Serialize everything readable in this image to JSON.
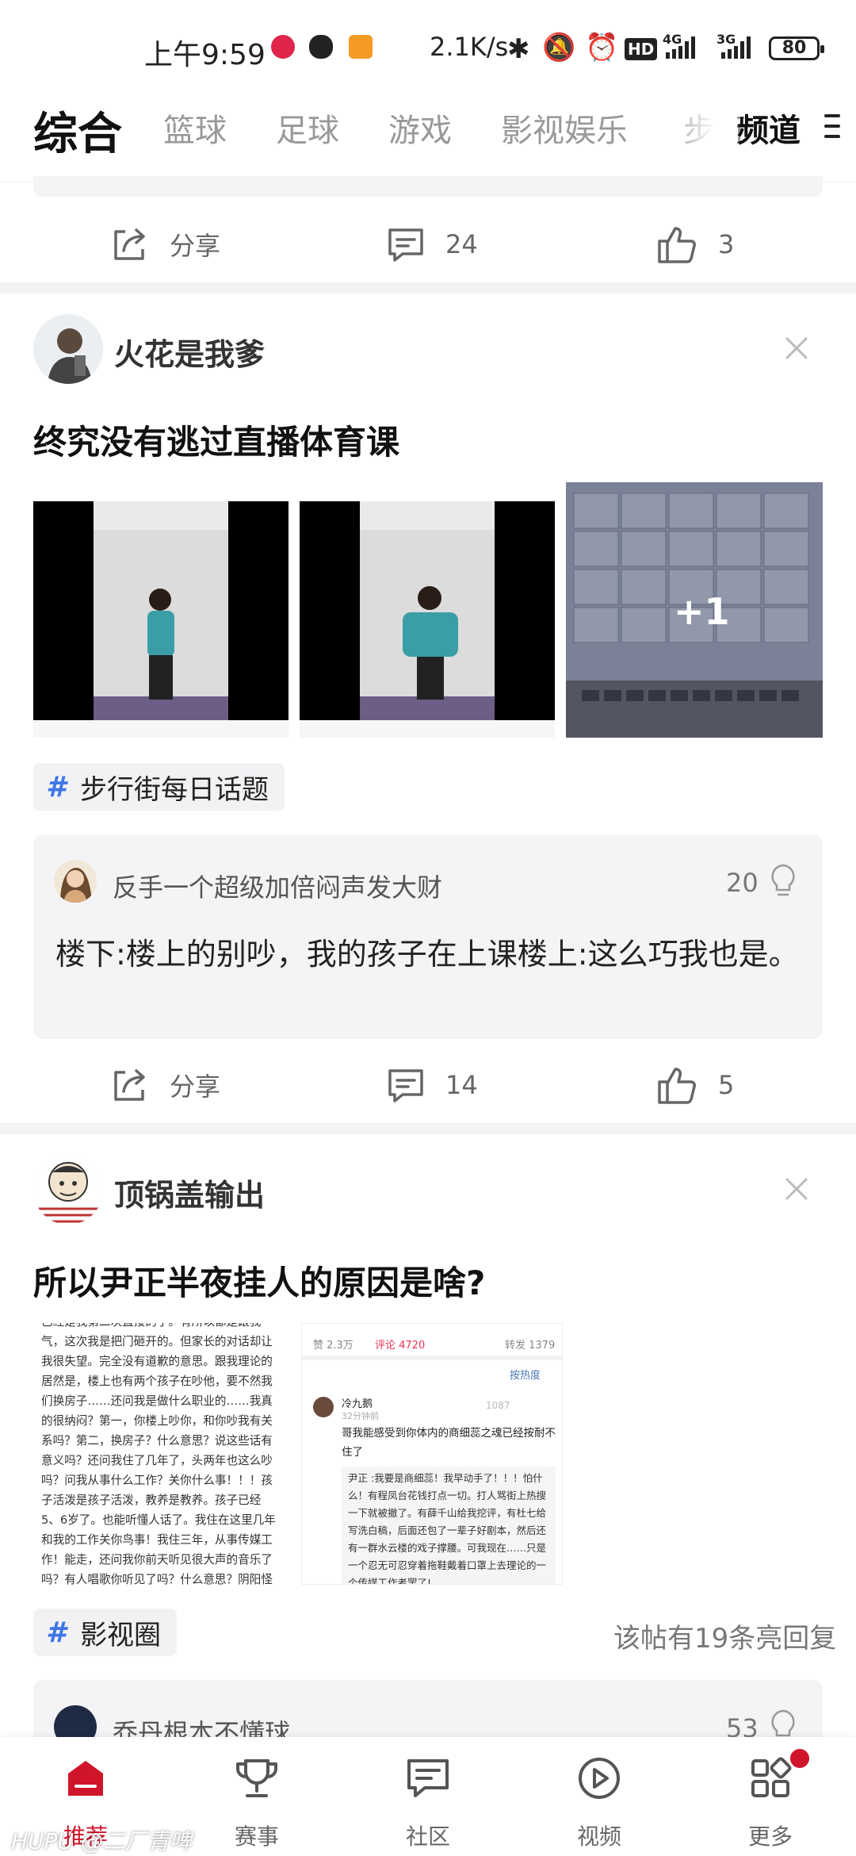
{
  "status_bar": {
    "time": "上午9:59",
    "network_speed": "2.1K/s",
    "hd": "HD",
    "net1": "4G",
    "net2": "3G",
    "battery": "80"
  },
  "tabs": {
    "items": [
      "综合",
      "篮球",
      "足球",
      "游戏",
      "影视娱乐",
      "步行"
    ],
    "channel_label": "频道"
  },
  "post0": {
    "share": "分享",
    "comments": "24",
    "likes": "3"
  },
  "post1": {
    "author": "火花是我爹",
    "title": "终究没有逃过直播体育课",
    "more_images": "+1",
    "topic": "步行街每日话题",
    "top_comment": {
      "user": "反手一个超级加倍闷声发大财",
      "lights": "20",
      "text": "楼下:楼上的别吵，我的孩子在上课楼上:这么巧我也是。"
    },
    "share": "分享",
    "comments": "14",
    "likes": "5"
  },
  "post2": {
    "author": "顶锅盖输出",
    "title": "所以尹正半夜挂人的原因是啥?",
    "topic": "影视圈",
    "hot_replies": "该帖有19条亮回复",
    "top_comment": {
      "user": "乔丹根本不懂球",
      "lights": "53"
    },
    "left_image_text": "已经是我第二次直接的了。有所以都是跟我气，这次我是把门砸开的。但家长的对话却让我很失望。完全没有道歉的意思。跟我理论的居然是，楼上也有两个孩子在吵他，要不然我们换房子……还问我是做什么职业的……我真的很纳闷？第一，你楼上吵你，和你吵我有关系吗？第二，换房子？什么意思？说这些话有意义吗？还问我住了几年了，头两年也这么吵吗？问我从事什么工作？关你什么事！！！孩子活泼是孩子活泼，教养是教养。孩子已经5、6岁了。也能听懂人话了。我住在这里几年和我的工作关你鸟事！我住三年，从事传媒工作！能走，还问我你前天听见很大声的音乐了吗？有人唱歌你听见了吗？什么意思？阴阳怪气。我问，我在卧室听的。吵到你了吗？唱歌？那",
    "right_image": {
      "likes": "赞 2.3万",
      "comments_tab": "评论 4720",
      "reposts": "转发 1379",
      "sort": "按热度",
      "commenter": "冷九鹅",
      "comment_time": "32分钟前",
      "comment_likes": "1087",
      "comment_text": "哥我能感受到你体内的商细蕊之魂已经按耐不住了",
      "reply": "尹正 :我要是商细蕊！我早动手了！！！怕什么！有程凤台花钱打点一切。打人骂街上热搜一下就被撤了。有薛千山给我挖评，有杜七给写洗白稿，后面还包了一辈子好剧本，然后还有一群水云楼的戏子撑腰。可我现在……只是一个忍无可忍穿着拖鞋戴着口罩上去理论的一个传媒工作者罢了!"
    }
  },
  "bottom_nav": {
    "items": [
      "推荐",
      "赛事",
      "社区",
      "视频",
      "更多"
    ]
  },
  "watermark": "HUPU @二厂青啤",
  "colors": {
    "accent": "#d0152a",
    "topic_hash": "#3f76e4"
  }
}
